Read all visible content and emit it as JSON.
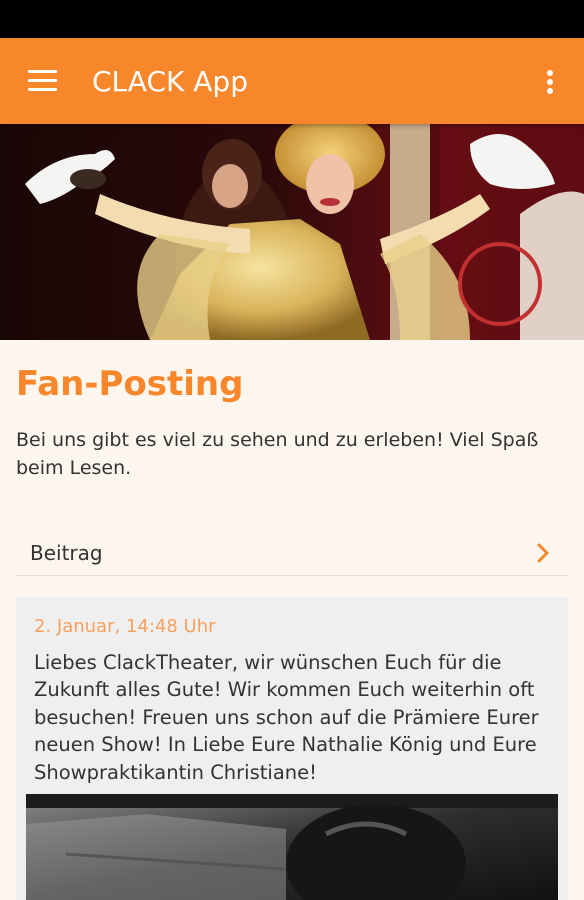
{
  "app_bar": {
    "title": "CLACK App",
    "color": "#f8862a",
    "menu_icon": "hamburger-menu-icon",
    "overflow_icon": "more-vert-icon"
  },
  "hero": {
    "description_icon": "performer-with-doves-photo"
  },
  "page": {
    "title": "Fan-Posting",
    "intro": "Bei uns gibt es viel zu sehen und zu erleben! Viel Spaß beim Lesen."
  },
  "beitrag": {
    "label": "Beitrag",
    "icon": "chevron-right-icon"
  },
  "post": {
    "date": "2. Januar, 14:48 Uhr",
    "text": "Liebes ClackTheater, wir wünschen Euch für die Zukunft alles Gute! Wir kommen Euch weiterhin oft besuchen! Freuen uns schon auf die Prämiere Eurer neuen Show! In Liebe Eure Nathalie König und Eure Showpraktikantin Christiane!"
  },
  "colors": {
    "accent": "#f8862a",
    "background": "#fcf6ee",
    "card": "#f0efef",
    "date": "#f8a05c"
  }
}
